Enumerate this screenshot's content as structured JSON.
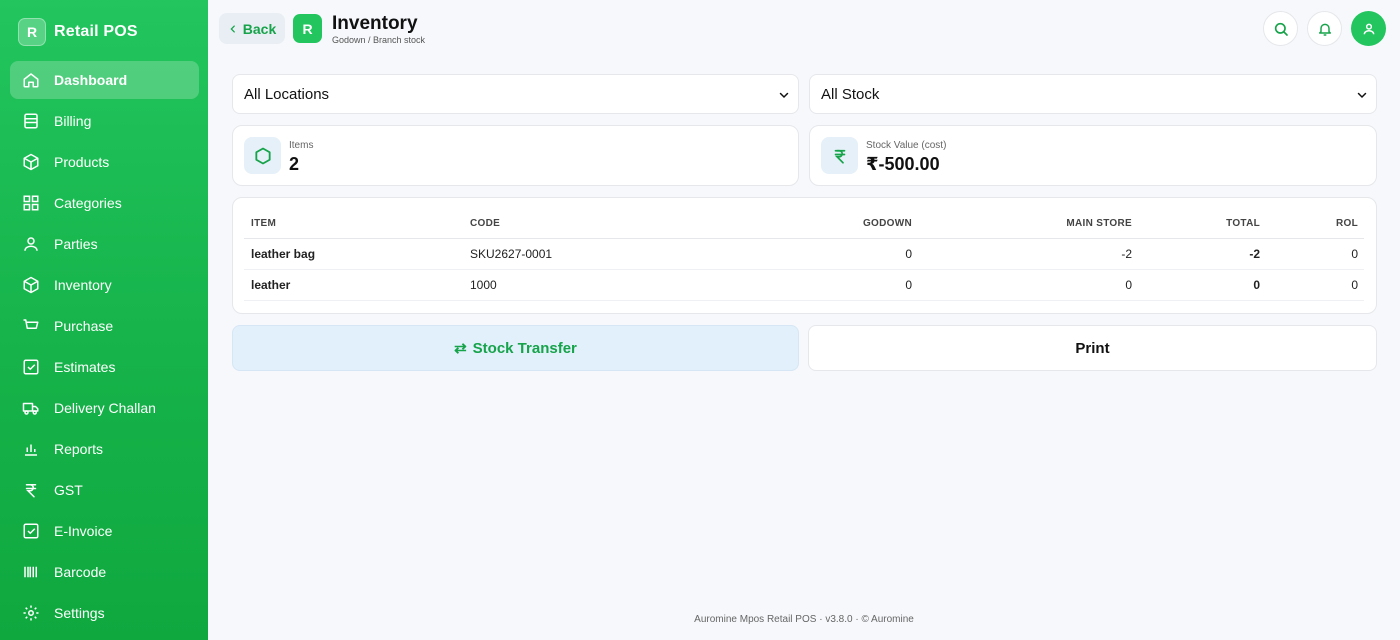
{
  "brand": {
    "logo_letter": "R",
    "name": "Retail POS"
  },
  "sidebar": {
    "items": [
      {
        "label": "Dashboard",
        "icon": "home-icon",
        "active": true
      },
      {
        "label": "Billing",
        "icon": "receipt-icon"
      },
      {
        "label": "Products",
        "icon": "box-icon"
      },
      {
        "label": "Categories",
        "icon": "grid-icon"
      },
      {
        "label": "Parties",
        "icon": "user-icon"
      },
      {
        "label": "Inventory",
        "icon": "package-icon"
      },
      {
        "label": "Purchase",
        "icon": "cart-icon"
      },
      {
        "label": "Estimates",
        "icon": "checklist-icon"
      },
      {
        "label": "Delivery Challan",
        "icon": "truck-icon"
      },
      {
        "label": "Reports",
        "icon": "bar-chart-icon"
      },
      {
        "label": "GST",
        "icon": "rupee-icon"
      },
      {
        "label": "E-Invoice",
        "icon": "invoice-check-icon"
      },
      {
        "label": "Barcode",
        "icon": "barcode-icon"
      },
      {
        "label": "Settings",
        "icon": "gear-icon"
      }
    ]
  },
  "header": {
    "back_label": "Back",
    "logo_letter": "R",
    "title": "Inventory",
    "subtitle": "Godown / Branch stock",
    "icons": [
      "search-icon",
      "bell-icon",
      "user-icon"
    ]
  },
  "filters": {
    "location": "All Locations",
    "stock": "All Stock"
  },
  "stats": {
    "items_label": "Items",
    "items_value": "2",
    "value_label": "Stock Value (cost)",
    "value_value": "₹-500.00"
  },
  "table": {
    "headers": [
      "ITEM",
      "CODE",
      "GODOWN",
      "MAIN STORE",
      "TOTAL",
      "ROL"
    ],
    "rows": [
      {
        "item": "leather bag",
        "code": "SKU2627-0001",
        "godown": "0",
        "main_store": "-2",
        "total": "-2",
        "rol": "0"
      },
      {
        "item": "leather",
        "code": "1000",
        "godown": "0",
        "main_store": "0",
        "total": "0",
        "rol": "0"
      }
    ]
  },
  "actions": {
    "transfer_icon": "⇄",
    "transfer_label": "Stock Transfer",
    "print_label": "Print"
  },
  "footer": {
    "text": "Auromine Mpos Retail POS · v3.8.0 · © Auromine"
  },
  "colors": {
    "primary": "#22c55e",
    "primary_dark": "#16a34a",
    "accent_light": "#e2f0fc"
  }
}
